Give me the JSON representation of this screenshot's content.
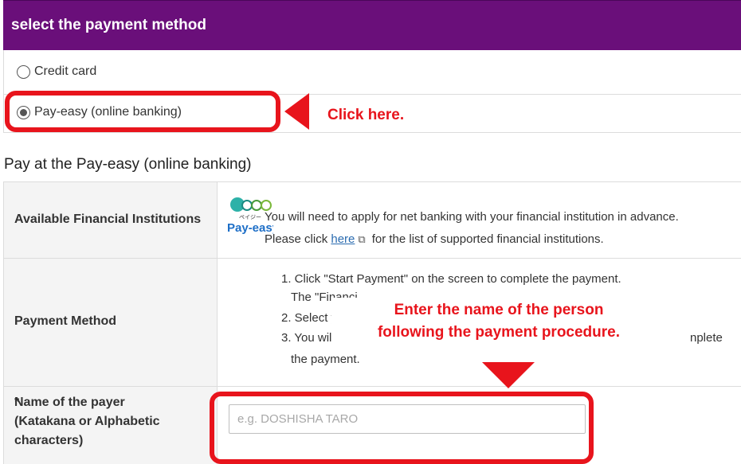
{
  "header": {
    "title": "select the payment method"
  },
  "payment_options": [
    {
      "label": "Credit card",
      "selected": false
    },
    {
      "label": "Pay-easy (online banking)",
      "selected": true
    }
  ],
  "section": {
    "title": "Pay at the Pay-easy (online banking)"
  },
  "table": {
    "institutions": {
      "label": "Available Financial Institutions",
      "logo_text": "Pay-easy",
      "logo_small": "ペイジー",
      "line1": "You will need to apply for net banking with your financial institution in advance.",
      "line2_prefix": "Please click",
      "link_text": "here",
      "link_icon": "external-link-icon",
      "line2_suffix": "for the list of supported financial institutions."
    },
    "method": {
      "label": "Payment Method",
      "steps": [
        "1. Click \"Start Payment\" on the screen to complete the payment.",
        "The \"Financi",
        "2. Select your fi",
        "3. You will be re",
        "nplete",
        "the payment."
      ]
    },
    "payer": {
      "label": "Name of the payer\n(Katakana or Alphabetic\ncharacters)",
      "required_mark": "*",
      "placeholder": "e.g. DOSHISHA TARO",
      "value": ""
    }
  },
  "annotations": {
    "click_here": "Click here.",
    "enter_name_line1": "Enter the name of the person",
    "enter_name_line2": "following the payment procedure.",
    "color": "#e8141c"
  },
  "colors": {
    "header_bg": "#6a0f7a",
    "link": "#2b6cb0",
    "label_bg": "#f4f4f4"
  }
}
